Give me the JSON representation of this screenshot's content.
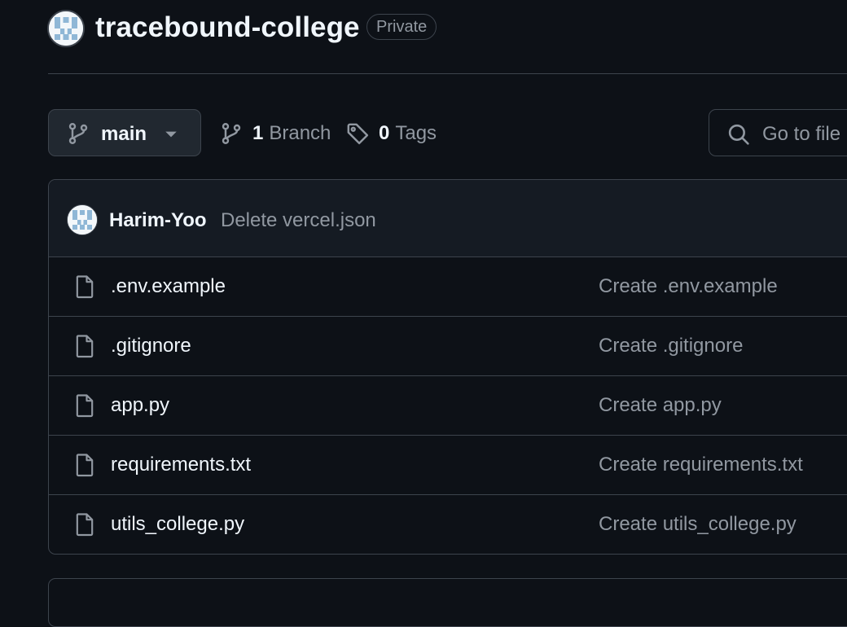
{
  "repo": {
    "name": "tracebound-college",
    "visibility": "Private",
    "avatar_icon": "identicon-avatar"
  },
  "toolbar": {
    "branch": "main",
    "branch_icon": "git-branch-icon",
    "branches": {
      "count": "1",
      "label": "Branch"
    },
    "tags": {
      "count": "0",
      "label": "Tags"
    },
    "search_placeholder": "Go to file"
  },
  "latest_commit": {
    "author": "Harim-Yoo",
    "message": "Delete vercel.json"
  },
  "files": [
    {
      "name": ".env.example",
      "commit": "Create .env.example"
    },
    {
      "name": ".gitignore",
      "commit": "Create .gitignore"
    },
    {
      "name": "app.py",
      "commit": "Create app.py"
    },
    {
      "name": "requirements.txt",
      "commit": "Create requirements.txt"
    },
    {
      "name": "utils_college.py",
      "commit": "Create utils_college.py"
    }
  ],
  "colors": {
    "background": "#0d1117",
    "border": "#3d444d",
    "muted_text": "#9198a1",
    "primary_text": "#f0f6fc"
  }
}
